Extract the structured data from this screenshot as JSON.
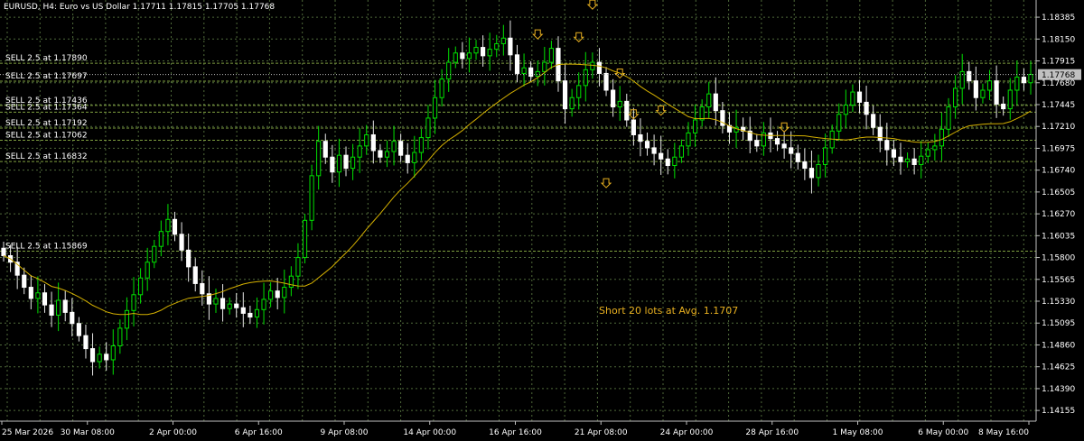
{
  "chart_data": {
    "type": "candlestick",
    "header": "EURUSD, H4:  Euro vs US Dollar  1.17711 1.17815 1.17705 1.17768",
    "current_price_label": "1.17768",
    "annotation": "Short 20 lots at Avg. 1.1707",
    "price_ticks": [
      "1.18385",
      "1.18150",
      "1.17915",
      "1.17680",
      "1.17445",
      "1.17210",
      "1.16975",
      "1.16740",
      "1.16505",
      "1.16270",
      "1.16035",
      "1.15800",
      "1.15565",
      "1.15330",
      "1.15095",
      "1.14860",
      "1.14625",
      "1.14390",
      "1.14155"
    ],
    "time_ticks": [
      "25 Mar 2026",
      "30 Mar 08:00",
      "2 Apr 00:00",
      "6 Apr 16:00",
      "9 Apr 08:00",
      "14 Apr 00:00",
      "16 Apr 16:00",
      "21 Apr 08:00",
      "24 Apr 00:00",
      "28 Apr 16:00",
      "1 May 08:00",
      "6 May 00:00",
      "8 May 16:00"
    ],
    "sell_orders": [
      {
        "label": "SELL 2.5 at 1.17890",
        "price": 1.1789
      },
      {
        "label": "SELL 2.5 at 1.17697",
        "price": 1.17697
      },
      {
        "label": "SELL 2.5 at 1.17436",
        "price": 1.17436
      },
      {
        "label": "SELL 2.5 at 1.17364",
        "price": 1.17364
      },
      {
        "label": "SELL 2.5 at 1.17192",
        "price": 1.17192
      },
      {
        "label": "SELL 2.5 at 1.17062",
        "price": 1.17062
      },
      {
        "label": "SELL 2.5 at 1.16832",
        "price": 1.16832
      },
      {
        "label": "SELL 2.5 at 1.15869",
        "price": 1.15869
      }
    ],
    "current_price": 1.17768,
    "ylim": [
      1.1404,
      1.1857
    ],
    "closes": [
      1.1582,
      1.1575,
      1.1561,
      1.1548,
      1.1536,
      1.1542,
      1.1529,
      1.1518,
      1.1534,
      1.1521,
      1.1509,
      1.1496,
      1.1482,
      1.1468,
      1.1476,
      1.147,
      1.1485,
      1.1504,
      1.1523,
      1.154,
      1.1558,
      1.1575,
      1.1592,
      1.1608,
      1.1621,
      1.1605,
      1.1588,
      1.157,
      1.1552,
      1.1541,
      1.153,
      1.1536,
      1.1525,
      1.153,
      1.1526,
      1.152,
      1.1516,
      1.1524,
      1.1535,
      1.1544,
      1.1537,
      1.1548,
      1.156,
      1.158,
      1.162,
      1.1668,
      1.1705,
      1.1688,
      1.1672,
      1.169,
      1.1676,
      1.1688,
      1.17,
      1.1712,
      1.1695,
      1.1688,
      1.1694,
      1.1705,
      1.169,
      1.1682,
      1.1693,
      1.1709,
      1.173,
      1.1752,
      1.1772,
      1.179,
      1.18,
      1.1794,
      1.18,
      1.1806,
      1.1797,
      1.1804,
      1.181,
      1.1816,
      1.1798,
      1.1778,
      1.1784,
      1.1775,
      1.178,
      1.179,
      1.1805,
      1.177,
      1.174,
      1.1752,
      1.1765,
      1.1782,
      1.179,
      1.1778,
      1.176,
      1.1742,
      1.1748,
      1.1728,
      1.1712,
      1.1705,
      1.1698,
      1.1692,
      1.1686,
      1.1679,
      1.1688,
      1.17,
      1.1714,
      1.1728,
      1.1742,
      1.1756,
      1.1738,
      1.1722,
      1.1715,
      1.172,
      1.1716,
      1.1706,
      1.17,
      1.1714,
      1.1708,
      1.1702,
      1.1698,
      1.1692,
      1.1683,
      1.1676,
      1.1666,
      1.168,
      1.1698,
      1.1716,
      1.1734,
      1.1744,
      1.1758,
      1.1747,
      1.1734,
      1.172,
      1.1706,
      1.1696,
      1.1688,
      1.1683,
      1.1686,
      1.168,
      1.1689,
      1.1696,
      1.17,
      1.1718,
      1.1742,
      1.1762,
      1.178,
      1.177,
      1.1752,
      1.176,
      1.177,
      1.1745,
      1.174,
      1.176,
      1.1774,
      1.1768,
      1.1777
    ]
  }
}
